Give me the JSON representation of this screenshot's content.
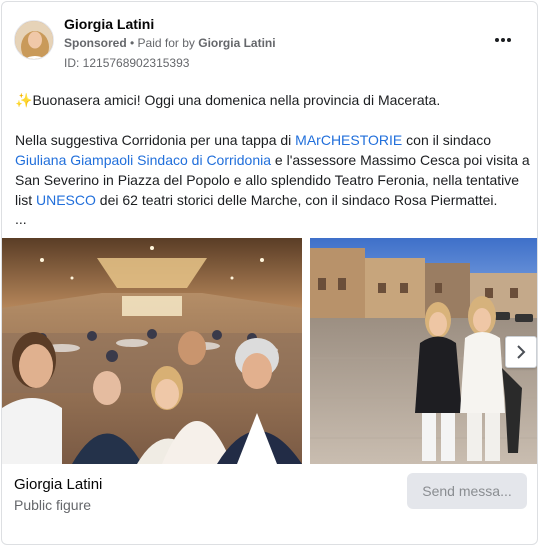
{
  "header": {
    "page_name": "Giorgia Latini",
    "sponsored": "Sponsored",
    "paid_for_prefix": " • Paid for by ",
    "payer": "Giorgia Latini",
    "ad_id": "ID: 1215768902315393",
    "more_icon": "more-horizontal-icon"
  },
  "post": {
    "sparkle": "✨",
    "greeting": "Buonasera amici! Oggi una domenica nella provincia di Macerata.",
    "p2_part1": "Nella suggestiva Corridonia per una tappa di ",
    "p2_link1": "MArCHESTORIE",
    "p2_part2": " con il sindaco ",
    "p2_link2": "Giuliana Giampaoli Sindaco di Corridonia",
    "p2_part3": " e l'assessore Massimo Cesca poi visita a San Severino in Piazza del Popolo e allo splendido Teatro Feronia, nella tentative list ",
    "p2_link3": "UNESCO",
    "p2_part4": " dei 62 teatri storici delle Marche, con il sindaco Rosa Piermattei.",
    "truncation": "..."
  },
  "carousel": {
    "photo1_desc": "group-selfie-banquet-hall",
    "photo2_desc": "two-women-piazza-evening",
    "next_icon": "chevron-right-icon"
  },
  "footer": {
    "name": "Giorgia Latini",
    "subtitle": "Public figure",
    "button": "Send messa..."
  },
  "colors": {
    "link": "#216fdb",
    "secondary_text": "#65676b",
    "button_bg": "#e4e6eb"
  }
}
